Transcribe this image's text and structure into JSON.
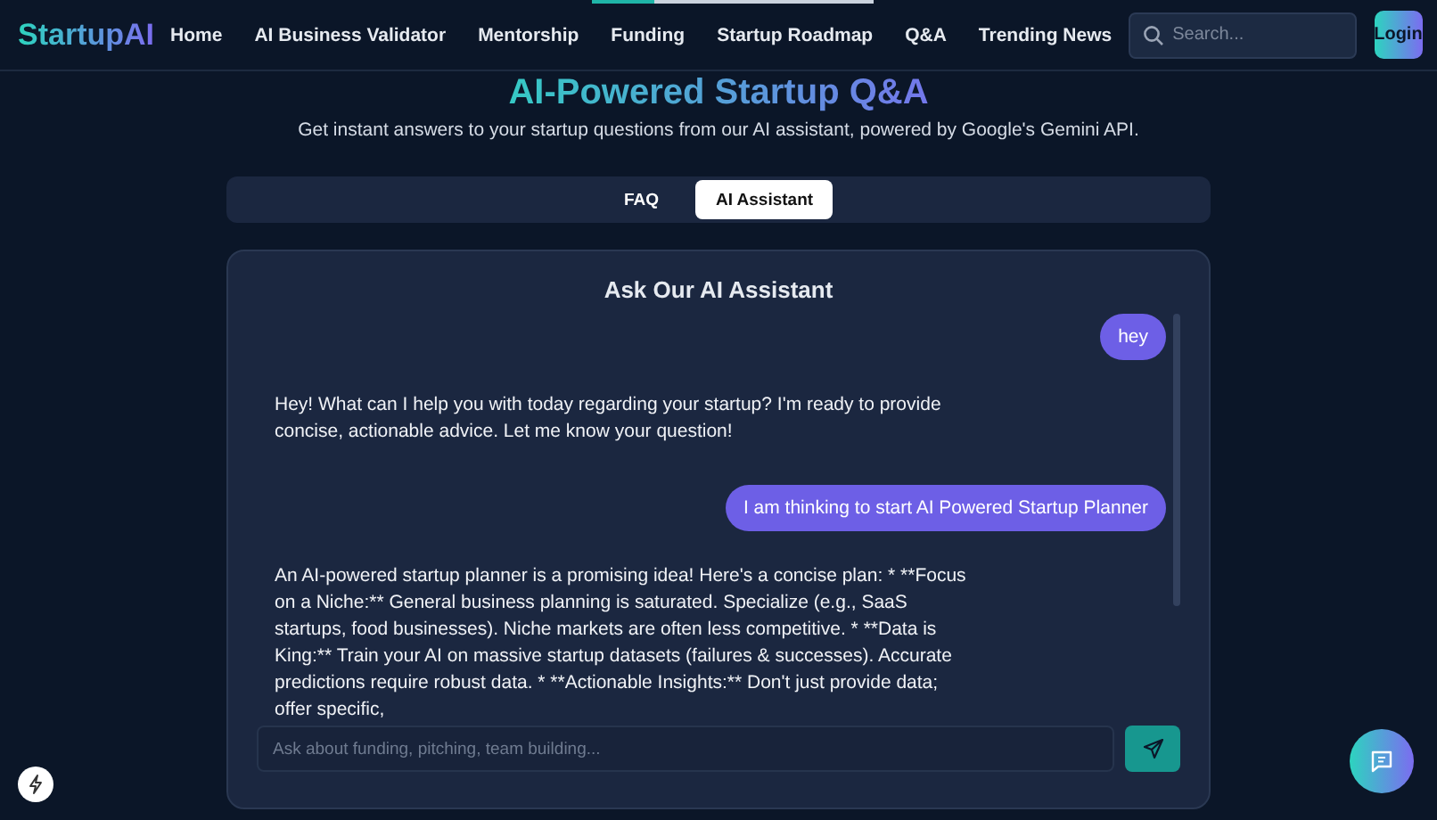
{
  "page_progress": {
    "level": 0.22
  },
  "header": {
    "logo": "StartupAI",
    "nav": [
      {
        "label": "Home",
        "selected": false
      },
      {
        "label": "AI Business Validator",
        "selected": false
      },
      {
        "label": "Mentorship",
        "selected": false
      },
      {
        "label": "Funding",
        "selected": false
      },
      {
        "label": "Startup Roadmap",
        "selected": false
      },
      {
        "label": "Q&A",
        "selected": false
      },
      {
        "label": "Trending News",
        "selected": false
      }
    ],
    "search": {
      "placeholder": "Search..."
    },
    "login": "Login"
  },
  "hero": {
    "title": "AI-Powered Startup Q&A",
    "subtitle": "Get instant answers to your startup questions from our AI assistant, powered by Google's Gemini API."
  },
  "tabs": [
    {
      "label": "FAQ",
      "selected": false
    },
    {
      "label": "AI Assistant",
      "selected": true
    }
  ],
  "chat": {
    "title": "Ask Our AI Assistant",
    "messages": [
      {
        "kind": "user",
        "text": "hey"
      },
      {
        "kind": "assistant",
        "text": "Hey! What can I help you with today regarding your startup? I'm ready to provide concise, actionable advice. Let me know your question!"
      },
      {
        "kind": "user",
        "text": "I am thinking to start AI Powered Startup Planner"
      },
      {
        "kind": "assistant",
        "text": "An AI-powered startup planner is a promising idea! Here's a concise plan: * **Focus on a Niche:** General business planning is saturated. Specialize (e.g., SaaS startups, food businesses). Niche markets are often less competitive. * **Data is King:** Train your AI on massive startup datasets (failures & successes). Accurate predictions require robust data. * **Actionable Insights:** Don't just provide data; offer specific,"
      }
    ],
    "input": {
      "placeholder": "Ask about funding, pitching, team building..."
    }
  }
}
